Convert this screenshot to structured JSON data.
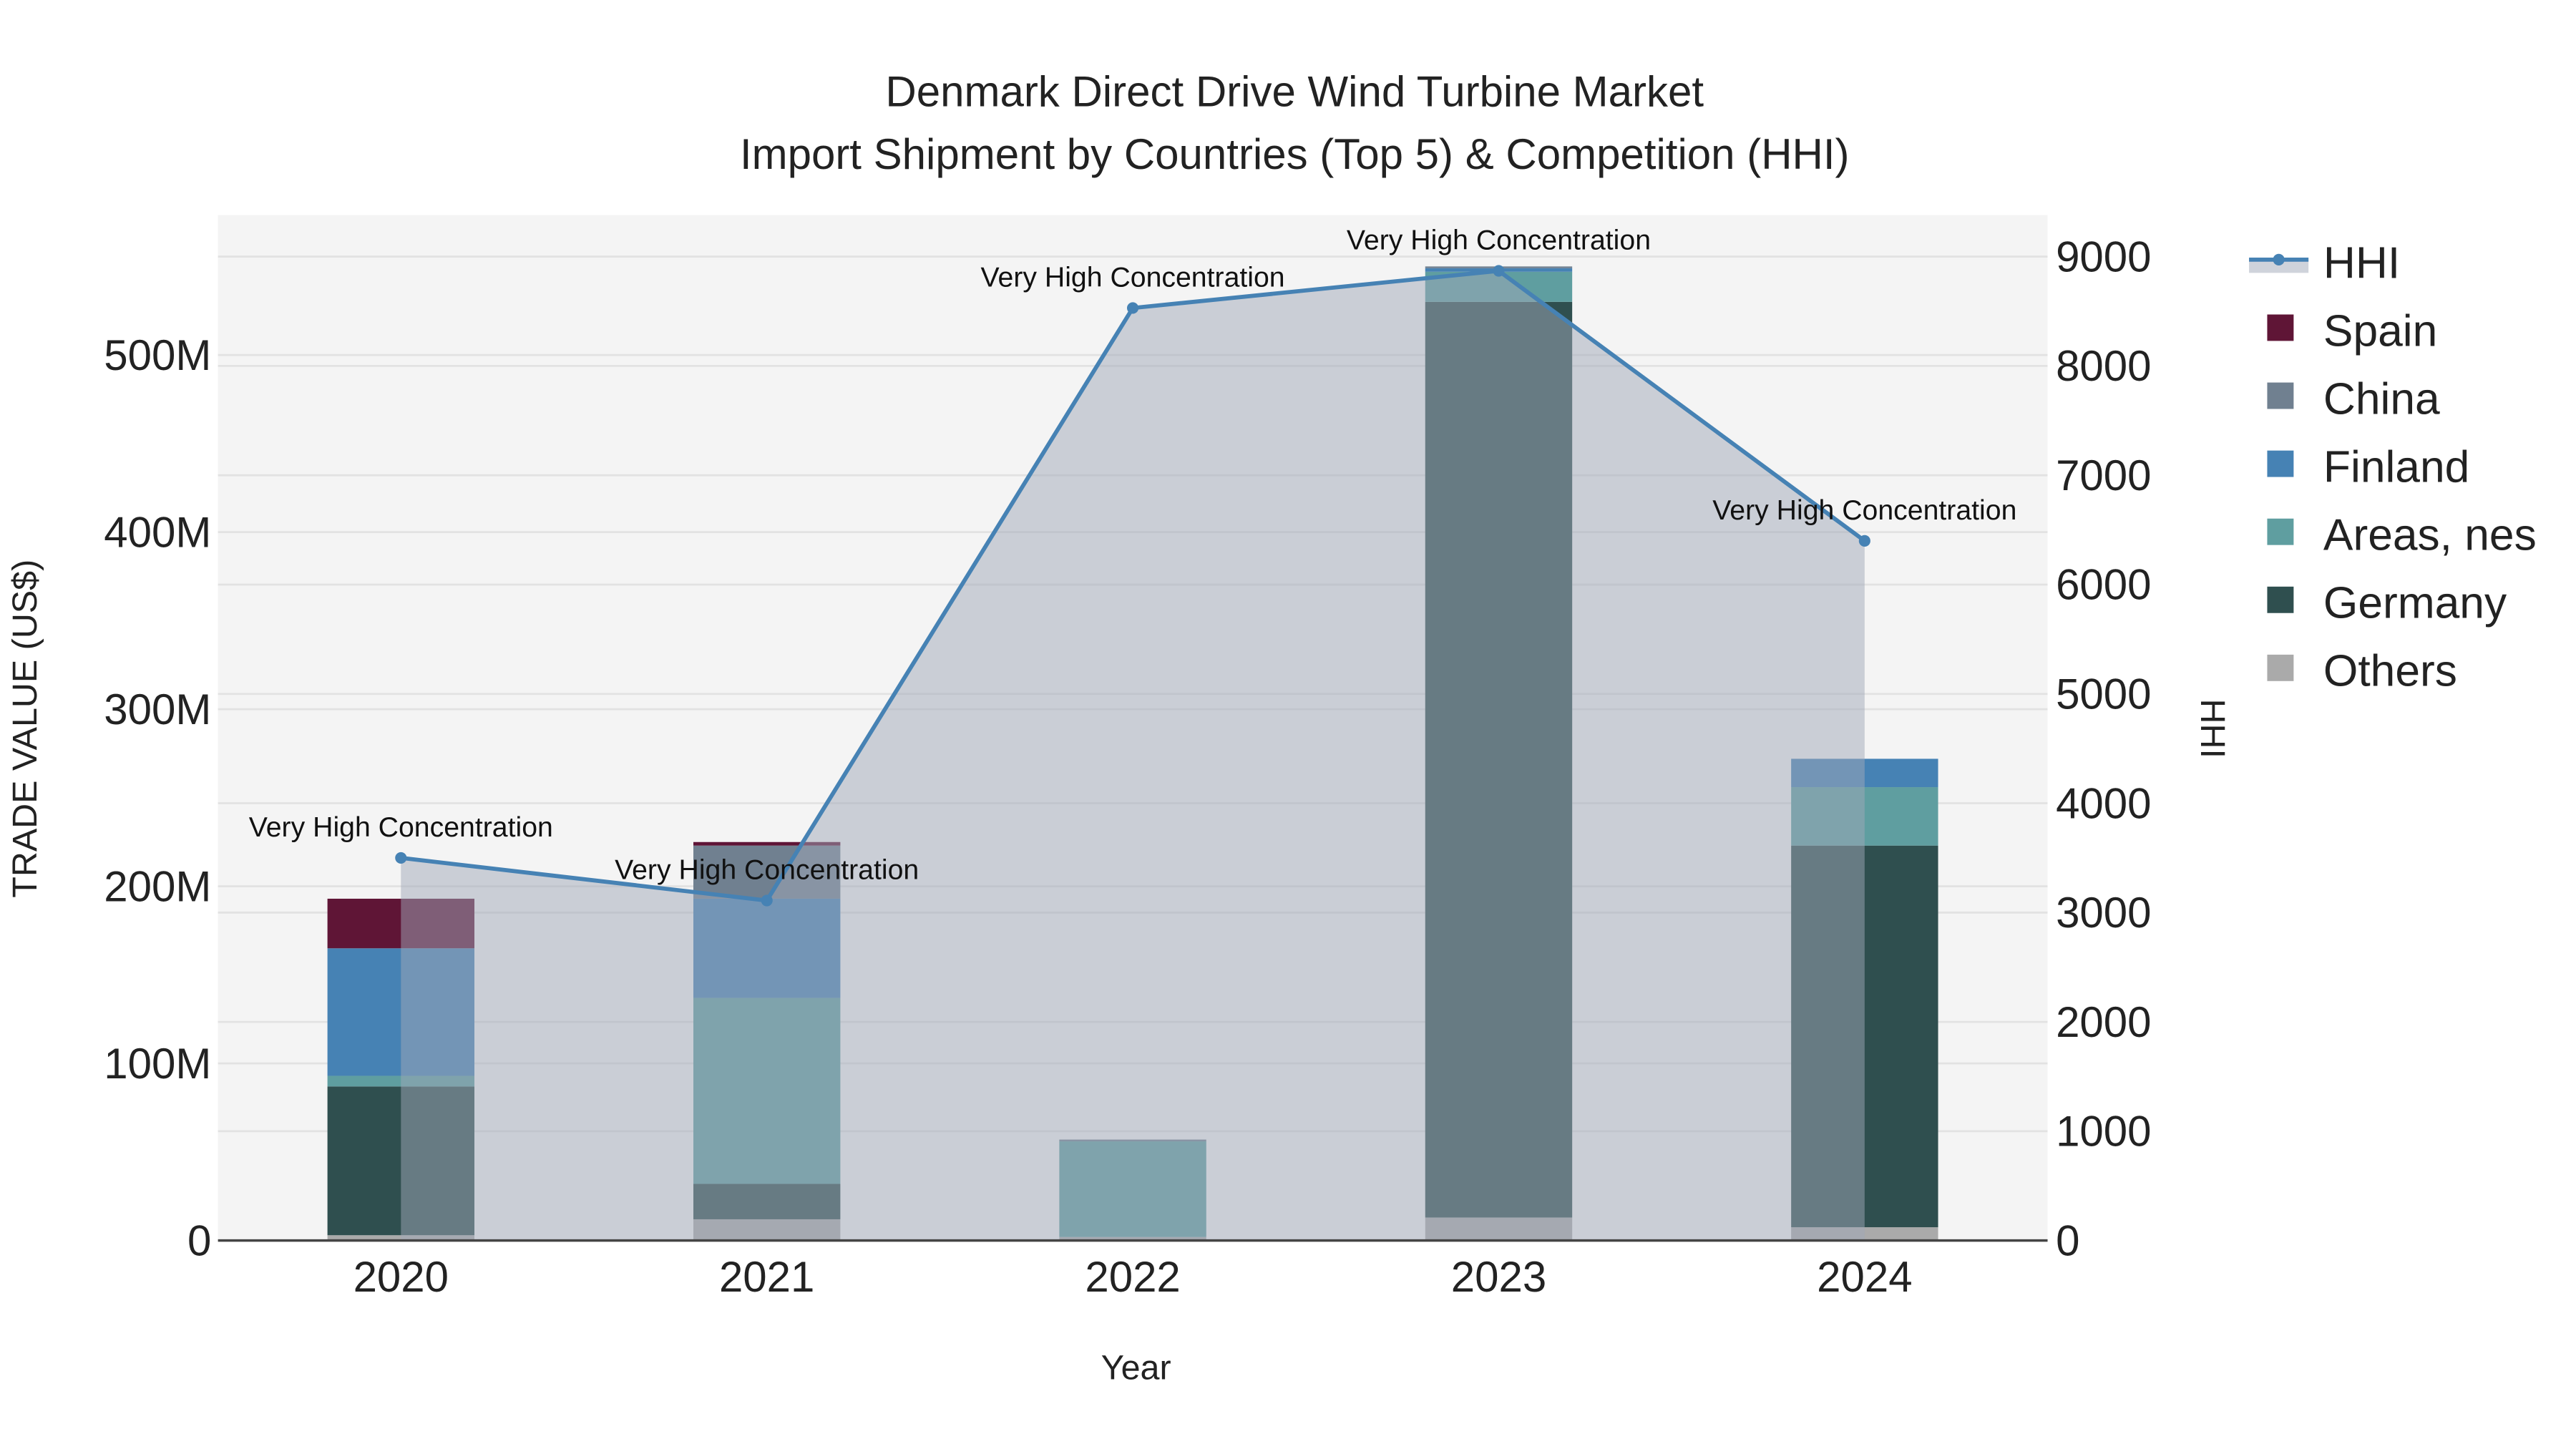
{
  "chart_data": {
    "type": "bar",
    "title": "Denmark Direct Drive Wind Turbine Market",
    "subtitle": "Import Shipment by Countries (Top 5) & Competition (HHI)",
    "xlabel": "Year",
    "ylabel": "TRADE VALUE (US$)",
    "y2label": "HHI",
    "categories": [
      "2020",
      "2021",
      "2022",
      "2023",
      "2024"
    ],
    "ylim": [
      0,
      579000000
    ],
    "y2lim": [
      0,
      9380
    ],
    "yticks": [
      {
        "v": 0,
        "label": "0"
      },
      {
        "v": 100000000,
        "label": "100M"
      },
      {
        "v": 200000000,
        "label": "200M"
      },
      {
        "v": 300000000,
        "label": "300M"
      },
      {
        "v": 400000000,
        "label": "400M"
      },
      {
        "v": 500000000,
        "label": "500M"
      }
    ],
    "y2ticks": [
      0,
      1000,
      2000,
      3000,
      4000,
      5000,
      6000,
      7000,
      8000,
      9000
    ],
    "grid": true,
    "legend_position": "right",
    "stacked": true,
    "series": [
      {
        "name": "Others",
        "color": "#aaaaaa",
        "values": [
          3000000,
          12000000,
          2000000,
          13000000,
          7500000
        ]
      },
      {
        "name": "Germany",
        "color": "#2f4f4f",
        "values": [
          84000000,
          20000000,
          0,
          517000000,
          215500000
        ]
      },
      {
        "name": "Areas, nes",
        "color": "#5f9ea0",
        "values": [
          6000000,
          105000000,
          54000000,
          17000000,
          33000000
        ]
      },
      {
        "name": "Finland",
        "color": "#4682b4",
        "values": [
          72000000,
          56000000,
          0,
          2000000,
          16000000
        ]
      },
      {
        "name": "China",
        "color": "#708090",
        "values": [
          0,
          30000000,
          1000000,
          1000000,
          0
        ]
      },
      {
        "name": "Spain",
        "color": "#5f1536",
        "values": [
          28000000,
          2000000,
          0,
          0,
          0
        ]
      }
    ],
    "hhi": {
      "name": "HHI",
      "color": "#4682b4",
      "values": [
        3500,
        3110,
        8530,
        8870,
        6400
      ],
      "annotations": [
        "Very High Concentration",
        "Very High Concentration",
        "Very High Concentration",
        "Very High Concentration",
        "Very High Concentration"
      ]
    },
    "legend_order": [
      "HHI",
      "Spain",
      "China",
      "Finland",
      "Areas, nes",
      "Germany",
      "Others"
    ]
  }
}
